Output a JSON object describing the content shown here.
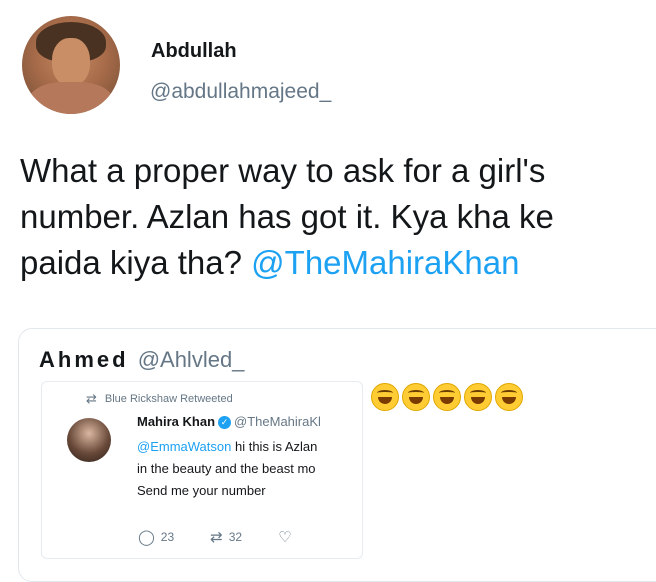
{
  "tweet": {
    "display_name": "Abdullah",
    "handle": "@abdullahmajeed_",
    "text_plain": "What a proper way to ask for a girl's number. Azlan has got it. Kya kha ke paida kiya tha?",
    "text_mention": "@TheMahiraKhan"
  },
  "quote": {
    "display_name": "Ahmed",
    "handle": "@Ahlvled_",
    "emoji_count": 5,
    "emoji_icon": "face-with-tears-of-joy-icon",
    "inner": {
      "retweet_label": "Blue Rickshaw Retweeted",
      "author_name": "Mahira Khan",
      "author_handle": "@TheMahiraKl",
      "text_mention": "@EmmaWatson",
      "text_line1": "hi this is Azlan",
      "text_line2": "in the beauty and the beast mo",
      "text_line3": "Send me your number",
      "replies": "23",
      "retweets": "32"
    }
  },
  "colors": {
    "link": "#1da1f2",
    "secondary_text": "#657786",
    "border": "#e1e8ed"
  }
}
